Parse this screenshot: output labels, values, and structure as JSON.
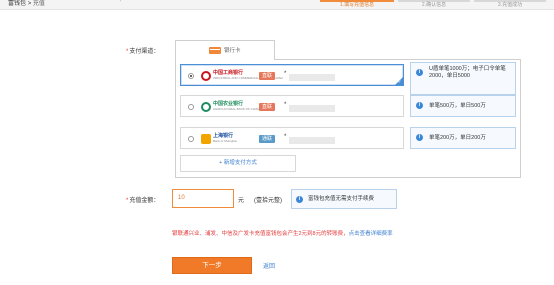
{
  "header": {
    "breadcrumb_root": "富钱包",
    "breadcrumb_sep": ">",
    "breadcrumb_current": "充值",
    "stray_mark": "'",
    "steps": [
      "1.填写充值信息",
      "2.确认信息",
      "3.充值成功"
    ]
  },
  "form": {
    "channel_label": "支付渠道：",
    "required_mark": "*",
    "channel_tab": "银行卡",
    "banks": [
      {
        "name": "中国工商银行",
        "sub": "INDUSTRIAL AND COMMERCIAL BANK OF CHINA",
        "tag": "直联",
        "card_prefix": "*",
        "selected": true,
        "limit_lines": [
          "U盾单笔1000万；电子口令单笔",
          "2000，单日5000"
        ]
      },
      {
        "name": "中国农业银行",
        "sub": "AGRICULTURAL BANK OF CHINA",
        "tag": "直联",
        "card_prefix": "*",
        "selected": false,
        "limit_lines": [
          "单笔500万，单日500万"
        ]
      },
      {
        "name": "上海银行",
        "sub": "Bank of Shanghai",
        "tag": "通联",
        "card_prefix": "*",
        "selected": false,
        "limit_lines": [
          "单笔200万，单日200万"
        ]
      }
    ],
    "add_method": "+ 新增支付方式",
    "amount_label": "充值金额：",
    "amount_value": "10",
    "amount_unit": "元",
    "amount_hint": "(壹拾元整)",
    "fee_note": "富钱包充值无需支付手续费",
    "warning_text": "银联通兴业、浦发、中信及广发卡充值富钱包会产生2元到8元的转账费，",
    "warning_link": "点击查看详细费率",
    "next_button": "下一步",
    "back_link": "返回"
  },
  "colors": {
    "accent": "#f07a28",
    "link": "#3b7ed0",
    "warning": "#e4393c",
    "tag_direct": "#e5785a",
    "tag_union": "#5a9ac8",
    "icbc": "#c8161d",
    "abc": "#1d8c5c",
    "bos": "#1b4f9c"
  }
}
